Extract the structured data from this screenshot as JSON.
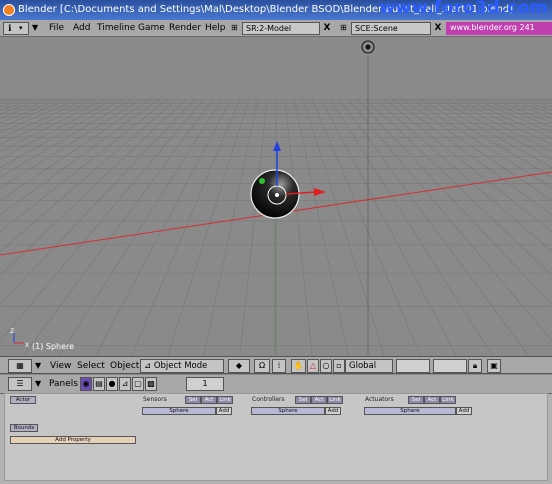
{
  "window": {
    "title": "Blender [C:\\Documents and Settings\\Mal\\Desktop\\Blender BSOD\\Blender\\bullet_ball_start01.blend]",
    "watermark": "www.foro3d.com"
  },
  "menubar": {
    "items": [
      "File",
      "Add",
      "Timeline",
      "Game",
      "Render",
      "Help"
    ],
    "screen_field": "SR:2-Model",
    "scene_field": "SCE:Scene",
    "close_glyph": "X",
    "url": "www.blender.org 241"
  },
  "viewport": {
    "object_label": "(1) Sphere",
    "axis_x_label": "X",
    "axis_z_label": "Z"
  },
  "view3d_header": {
    "menus": [
      "View",
      "Select",
      "Object"
    ],
    "mode": "Object Mode",
    "orientation": "Global"
  },
  "buttons": {
    "panels_label": "Panels",
    "frame": "1",
    "actor_label": "Actor",
    "bounds_label": "Bounds",
    "add_property_label": "Add Property",
    "sensors": {
      "title": "Sensors",
      "sel": "Sel",
      "act": "Act",
      "link": "Link",
      "object": "Sphere",
      "add": "Add"
    },
    "controllers": {
      "title": "Controllers",
      "sel": "Sel",
      "act": "Act",
      "link": "Link",
      "object": "Sphere",
      "add": "Add"
    },
    "actuators": {
      "title": "Actuators",
      "sel": "Sel",
      "act": "Act",
      "link": "Link",
      "object": "Sphere",
      "add": "Add"
    }
  },
  "colors": {
    "title_bar": "#3a64c0",
    "viewport_bg": "#8a8a8a",
    "x_axis": "#e03030",
    "y_axis": "#30a030",
    "z_axis": "#2040e0",
    "url_bg": "#c040b0"
  }
}
